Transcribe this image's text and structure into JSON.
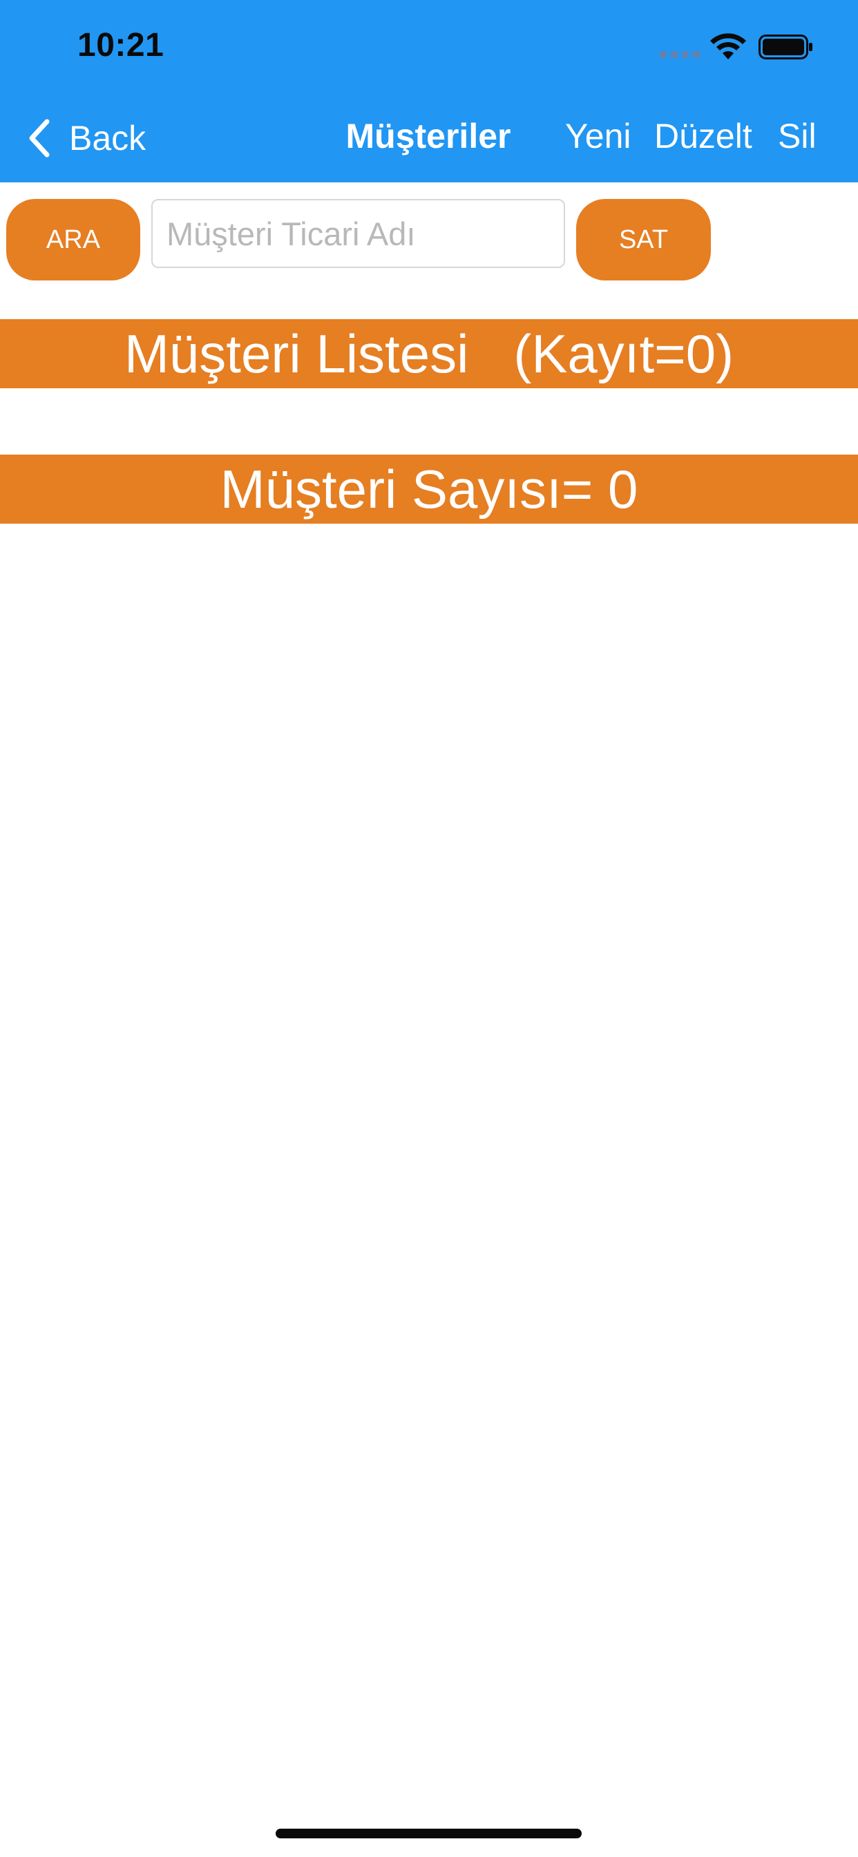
{
  "status_bar": {
    "time": "10:21"
  },
  "nav": {
    "back_label": "Back",
    "title": "Müşteriler",
    "actions": {
      "new": "Yeni",
      "edit": "Düzelt",
      "delete": "Sil"
    }
  },
  "search": {
    "search_button": "ARA",
    "placeholder": "Müşteri Ticari Adı",
    "value": "",
    "sell_button": "SAT"
  },
  "list_header": "Müşteri Listesi   (Kayıt=0)",
  "customer_count": "Müşteri Sayısı= 0",
  "colors": {
    "header_blue": "#2196F3",
    "accent_orange": "#E67E22",
    "text_white": "#FFFFFF"
  },
  "icons": {
    "back": "chevron-left-icon",
    "signal": "cellular-signal-icon",
    "wifi": "wifi-icon",
    "battery": "battery-icon"
  }
}
